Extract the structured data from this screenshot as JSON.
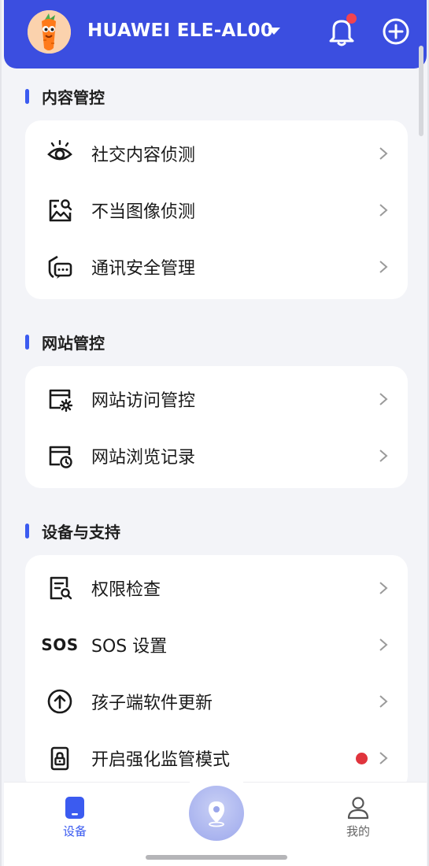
{
  "header": {
    "device_name": "HUAWEI ELE-AL00",
    "has_notification": true,
    "colors": {
      "bar": "#3b4ee0",
      "badge": "#f2434f"
    }
  },
  "sections": [
    {
      "title": "内容管控",
      "items": [
        {
          "label": "社交内容侦测",
          "icon": "eye-icon"
        },
        {
          "label": "不当图像侦测",
          "icon": "image-search-icon"
        },
        {
          "label": "通讯安全管理",
          "icon": "chat-shield-icon"
        }
      ]
    },
    {
      "title": "网站管控",
      "items": [
        {
          "label": "网站访问管控",
          "icon": "browser-settings-icon"
        },
        {
          "label": "网站浏览记录",
          "icon": "browser-history-icon"
        }
      ]
    },
    {
      "title": "设备与支持",
      "items": [
        {
          "label": "权限检查",
          "icon": "document-search-icon"
        },
        {
          "label": "SOS 设置",
          "icon": "sos-icon",
          "icon_text": "SOS"
        },
        {
          "label": "孩子端软件更新",
          "icon": "upload-circle-icon"
        },
        {
          "label": "开启强化监管模式",
          "icon": "lock-icon",
          "badge": true
        }
      ]
    }
  ],
  "bottom_nav": {
    "device_label": "设备",
    "mine_label": "我的",
    "active": "device",
    "accent": "#3b5bf0"
  }
}
